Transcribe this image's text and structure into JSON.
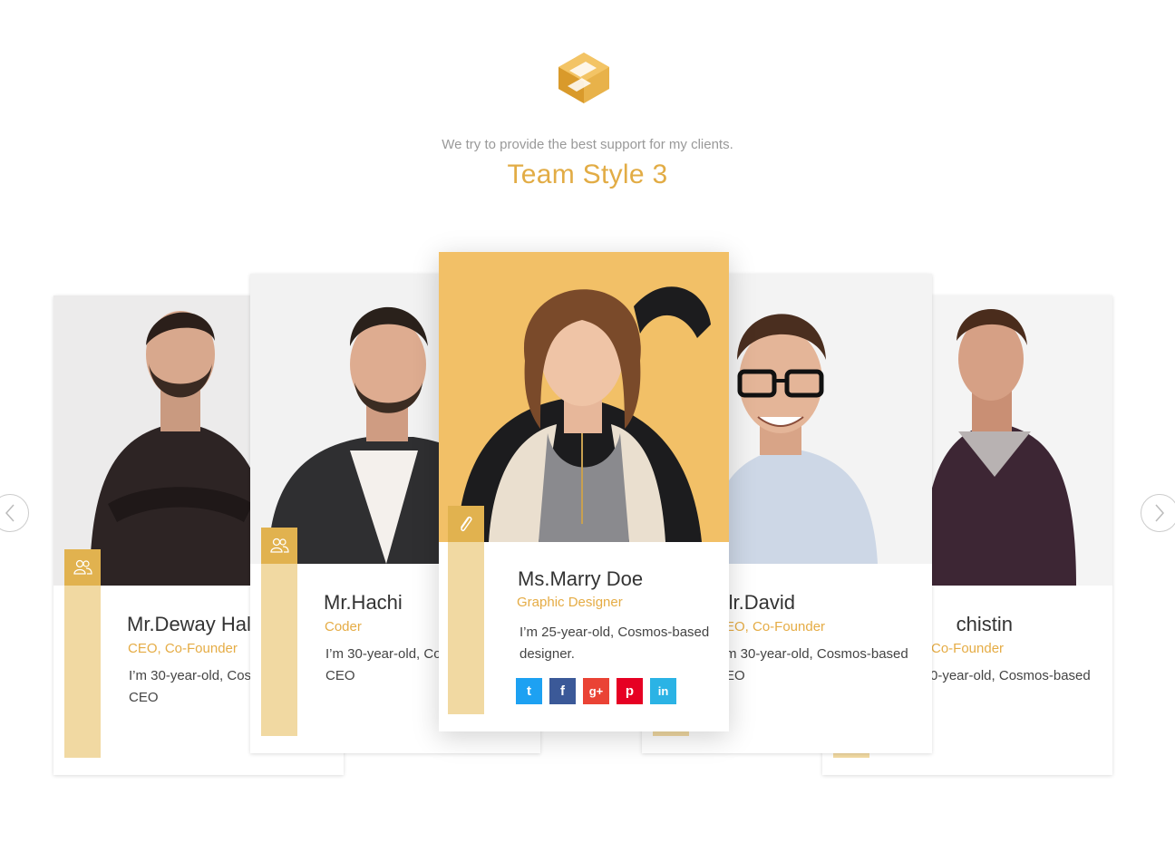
{
  "header": {
    "logo": "cube-logo-icon",
    "subtitle": "We try to provide the best support for my clients.",
    "title": "Team Style 3"
  },
  "colors": {
    "accent": "#e2ac45",
    "strip": "#f1d9a2",
    "icon_box": "#e1b24f",
    "twitter": "#1da1f2",
    "facebook": "#3b5998",
    "google_plus": "#ea4335",
    "pinterest": "#e60023",
    "linkedin": "#2bb3e5"
  },
  "carousel": {
    "prev_icon": "chevron-left-icon",
    "next_icon": "chevron-right-icon"
  },
  "members": [
    {
      "name": "Mr.Deway Hal",
      "role": "CEO, Co-Founder",
      "bio_line1": "I’m 30-year-old, Cosi",
      "bio_line2": "CEO",
      "icon": "users-icon"
    },
    {
      "name": "Mr.Hachi",
      "role": "Coder",
      "bio_line1": "I’m 30-year-old, Co",
      "bio_line2": "CEO",
      "icon": "users-icon"
    },
    {
      "name": "Ms.Marry Doe",
      "role": "Graphic Designer",
      "bio_line1": "I’m 25-year-old, Cosmos-based",
      "bio_line2": "designer.",
      "icon": "paperclip-icon",
      "social": [
        "twitter",
        "facebook",
        "google-plus",
        "pinterest",
        "linkedin"
      ],
      "social_labels": [
        "t",
        "f",
        "g+",
        "p",
        "in"
      ]
    },
    {
      "name": "lr.David",
      "role": "EO, Co-Founder",
      "bio_line1": "m 30-year-old, Cosmos-based",
      "bio_line2": "EO"
    },
    {
      "name": "chistin",
      "role": "Co-Founder",
      "bio_line1": "0-year-old, Cosmos-based"
    }
  ]
}
